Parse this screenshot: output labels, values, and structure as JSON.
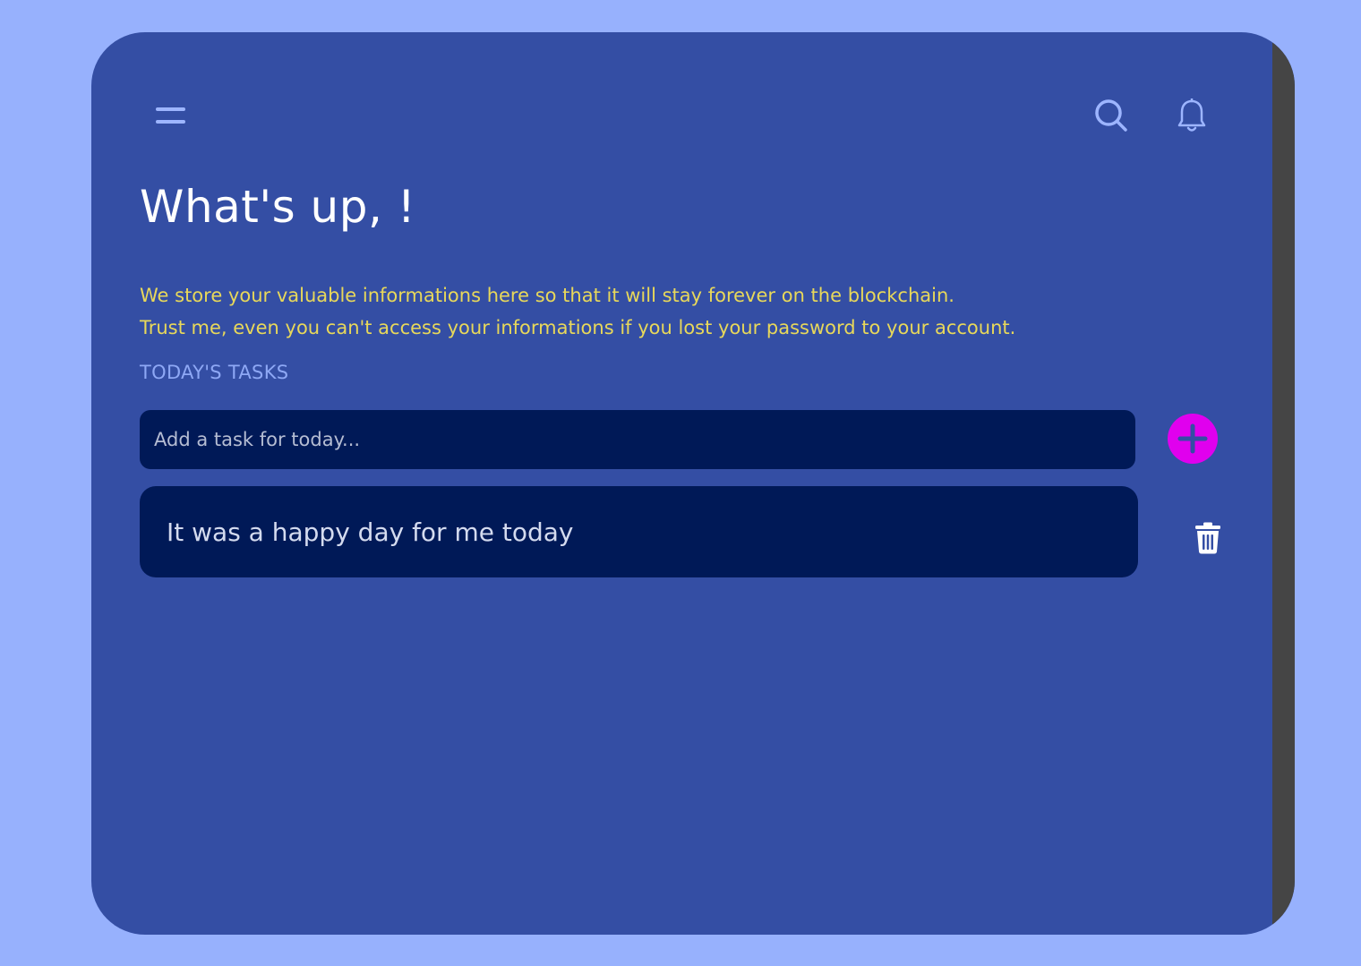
{
  "header": {
    "menu_icon": "hamburger-menu-icon",
    "search_icon": "search-icon",
    "notifications_icon": "bell-icon"
  },
  "greeting": {
    "title": "What's up, !"
  },
  "intro": {
    "line1": "We store your valuable informations here so that it will stay forever on the blockchain.",
    "line2": "Trust me, even you can't access your informations if you lost your password to your account."
  },
  "tasks_section": {
    "label": "TODAY'S TASKS",
    "input_placeholder": "Add a task for today...",
    "input_value": "",
    "add_icon": "plus-icon",
    "items": [
      {
        "text": "It was a happy day for me today",
        "delete_icon": "trash-icon"
      }
    ]
  },
  "colors": {
    "page_background": "#97b1fd",
    "card_background": "#344ea4",
    "input_background": "#001957",
    "accent_add": "#e000ee",
    "intro_text": "#e8d85a",
    "section_label": "#8ea8f5"
  }
}
